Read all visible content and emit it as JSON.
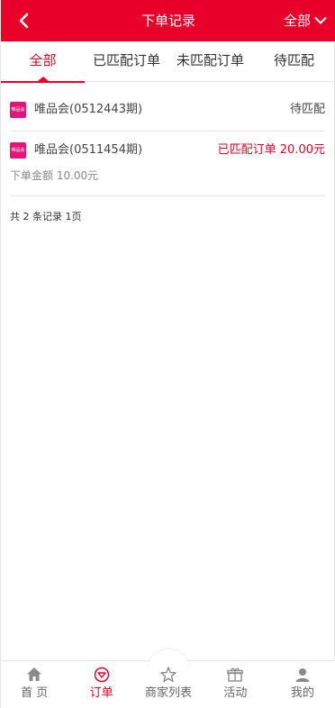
{
  "header": {
    "title": "下单记录",
    "filter_label": "全部",
    "back_icon": "chevron-left-icon",
    "filter_icon": "chevron-down-icon",
    "accent_color": "#e8002a"
  },
  "tabs": [
    {
      "label": "全部",
      "active": true
    },
    {
      "label": "已匹配订单",
      "active": false
    },
    {
      "label": "未匹配订单",
      "active": false
    },
    {
      "label": "待匹配",
      "active": false
    }
  ],
  "orders": [
    {
      "logo_text": "唯品会",
      "name": "唯品会(0512443期)",
      "status": "待匹配",
      "status_color": "#444444"
    },
    {
      "logo_text": "唯品会",
      "name": "唯品会(0511454期)",
      "status": "已匹配订单 20.00元",
      "status_color": "#e8002a",
      "amount": "下单金额 10.00元"
    }
  ],
  "summary": "共 2 条记录 1页",
  "tabbar": [
    {
      "label": "首 页",
      "icon": "home-icon",
      "active": false
    },
    {
      "label": "订单",
      "icon": "order-icon",
      "active": true
    },
    {
      "label": "商家列表",
      "icon": "star-icon",
      "active": false
    },
    {
      "label": "活动",
      "icon": "gift-icon",
      "active": false
    },
    {
      "label": "我的",
      "icon": "user-icon",
      "active": false
    }
  ]
}
